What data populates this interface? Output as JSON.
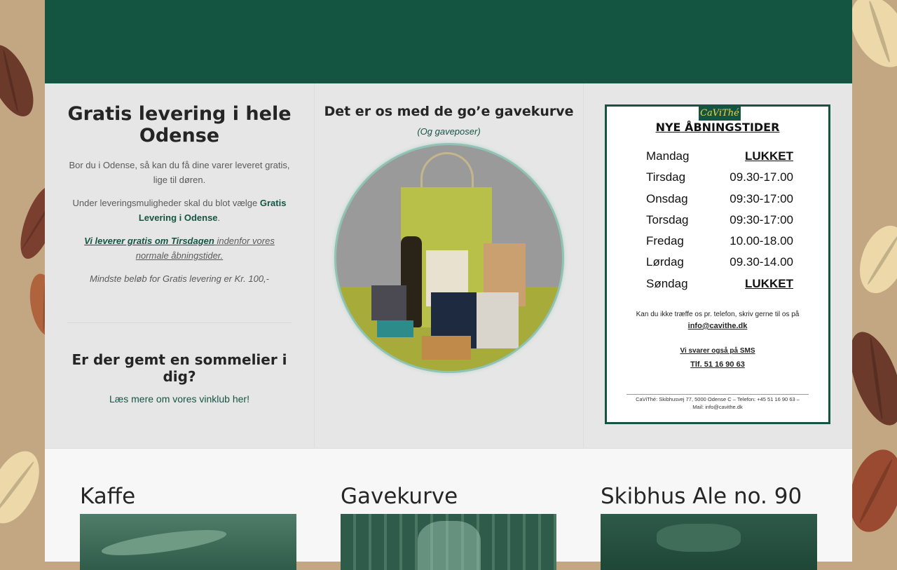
{
  "delivery": {
    "title": "Gratis levering i hele Odense",
    "p1": "Bor du i Odense, så kan du få dine varer leveret gratis, lige til døren.",
    "p2_text": "Under leveringsmuligheder skal du blot vælge ",
    "p2_link": "Gratis Levering i Odense",
    "p2_end": ".",
    "p3_bold": "Vi leverer gratis om Tirsdagen",
    "p3_rest": " indenfor vores normale åbningstider.",
    "p4": "Mindste beløb for Gratis levering er Kr. 100,-",
    "sommelier_title": "Er der gemt en sommelier i dig?",
    "wine_link": "Læs mere om vores vinklub her!"
  },
  "giftbasket": {
    "title": "Det er os med de go’e gavekurve",
    "subtitle": "(Og gaveposer)"
  },
  "hours_sign": {
    "logo": "CaViThé",
    "title": "NYE ÅBNINGSTIDER",
    "days": [
      {
        "day": "Mandag",
        "time": "LUKKET",
        "closed": true
      },
      {
        "day": "Tirsdag",
        "time": "09.30-17.00",
        "closed": false
      },
      {
        "day": "Onsdag",
        "time": "09:30-17:00",
        "closed": false
      },
      {
        "day": "Torsdag",
        "time": "09:30-17:00",
        "closed": false
      },
      {
        "day": "Fredag",
        "time": "10.00-18.00",
        "closed": false
      },
      {
        "day": "Lørdag",
        "time": "09.30-14.00",
        "closed": false
      },
      {
        "day": "Søndag",
        "time": "LUKKET",
        "closed": true
      }
    ],
    "contact_text": "Kan du ikke træffe os pr. telefon, skriv gerne til os på",
    "email": "info@cavithe.dk",
    "sms_text": "Vi svarer også på SMS",
    "phone": "Tlf. 51 16 90 63",
    "footer_line1": "CaViThé: Skibhusvej 77, 5000 Odense C – Telefon: +45 51 16 90 63 –",
    "footer_line2": "Mail: info@cavithe.dk"
  },
  "products": [
    {
      "title": "Kaffe"
    },
    {
      "title": "Gavekurve"
    },
    {
      "title": "Skibhus Ale no. 90"
    }
  ]
}
